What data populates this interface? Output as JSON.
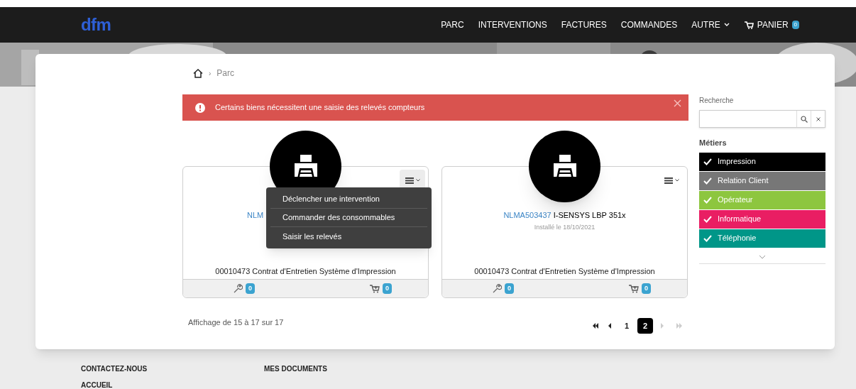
{
  "nav": {
    "logo": "dfm",
    "items": [
      {
        "label": "PARC",
        "kind": "link"
      },
      {
        "label": "INTERVENTIONS",
        "kind": "link"
      },
      {
        "label": "FACTURES",
        "kind": "link"
      },
      {
        "label": "COMMANDES",
        "kind": "link"
      },
      {
        "label": "AUTRE",
        "kind": "dropdown"
      },
      {
        "label": "PANIER",
        "kind": "cart",
        "badge": "0"
      }
    ]
  },
  "breadcrumb": [
    {
      "separator": "›",
      "label": "Parc"
    }
  ],
  "alert": {
    "text": "Certains biens nécessitent une saisie des relevés compteurs"
  },
  "products": [
    {
      "reference": "NLM",
      "contract": "00010473 Contrat d'Entretien Système d'Impression",
      "interventions": "0",
      "orders": "0",
      "menu_open": true,
      "menu": [
        "Déclencher une intervention",
        "Commander des consommables",
        "Saisir les relevés"
      ]
    },
    {
      "reference": "NLMA503437",
      "model": "I-SENSYS LBP 351x",
      "installed": "Installé le 18/10/2021",
      "contract": "00010473 Contrat d'Entretien Système d'Impression",
      "interventions": "0",
      "orders": "0",
      "menu_open": false
    }
  ],
  "pagination": {
    "summary": "Affichage de 15 à 17 sur 17",
    "pages": [
      {
        "label": "1",
        "selected": false
      },
      {
        "label": "2",
        "selected": true
      }
    ]
  },
  "sidebar": {
    "search_label": "Recherche",
    "filters_title": "Métiers",
    "filters": [
      {
        "label": "Impression",
        "color": "#000000",
        "checked": true
      },
      {
        "label": "Relation Client",
        "color": "#777777",
        "checked": true
      },
      {
        "label": "Opérateur",
        "color": "#8dc63f",
        "checked": true
      },
      {
        "label": "Informatique",
        "color": "#e91e63",
        "checked": true
      },
      {
        "label": "Téléphonie",
        "color": "#009688",
        "checked": true
      }
    ]
  },
  "footer": {
    "columns": [
      [
        "CONTACTEZ-NOUS",
        "ACCUEIL"
      ],
      [
        "MES DOCUMENTS"
      ]
    ]
  }
}
